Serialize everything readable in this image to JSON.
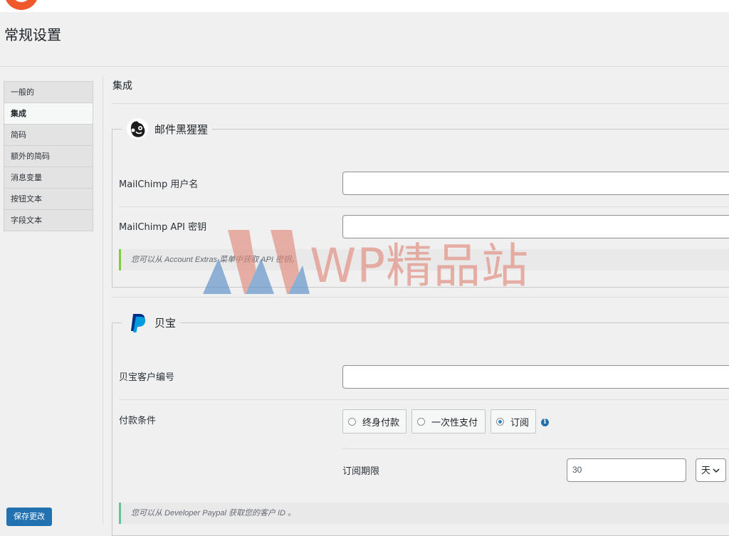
{
  "page": {
    "title": "常规设置"
  },
  "sidebar": {
    "items": [
      {
        "label": "一般的"
      },
      {
        "label": "集成"
      },
      {
        "label": "简码"
      },
      {
        "label": "额外的简码"
      },
      {
        "label": "消息变量"
      },
      {
        "label": "按钮文本"
      },
      {
        "label": "字段文本"
      }
    ],
    "save_label": "保存更改"
  },
  "main": {
    "heading": "集成",
    "mailchimp": {
      "legend": "邮件黑猩猩",
      "username_label": "MailChimp 用户名",
      "username_value": "",
      "apikey_label": "MailChimp API 密钥",
      "apikey_value": "",
      "note": "您可以从 Account Extras 菜单中获取 API 密钥。"
    },
    "paypal": {
      "legend": "贝宝",
      "client_id_label": "贝宝客户编号",
      "client_id_value": "",
      "payment_terms_label": "付款条件",
      "options": [
        {
          "label": "终身付款",
          "checked": false
        },
        {
          "label": "一次性支付",
          "checked": false
        },
        {
          "label": "订阅",
          "checked": true
        }
      ],
      "subscription_period_label": "订阅期限",
      "period_value": "30",
      "period_unit": "天",
      "note": "您可以从 Developer Paypal 获取您的客户 ID 。"
    }
  },
  "watermark": {
    "text": "WP精品站"
  },
  "colors": {
    "primary": "#2271b1",
    "background": "#f0f0f1",
    "note_border": "#7ad03a",
    "watermark": "#e08a7c"
  }
}
